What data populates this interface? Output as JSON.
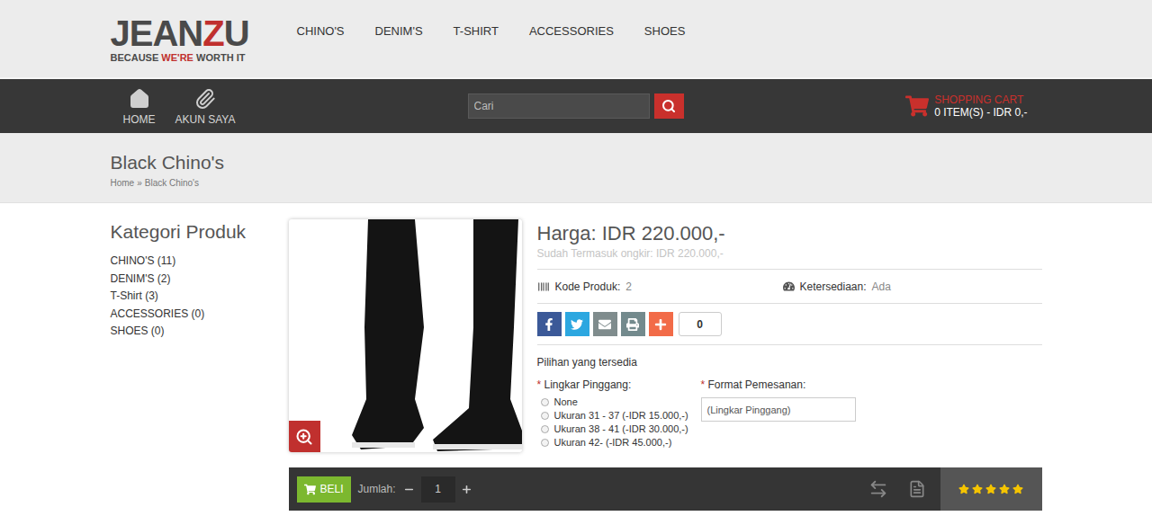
{
  "logo": {
    "title": [
      {
        "text": "JEAN",
        "highlight": false
      },
      {
        "text": "Z",
        "highlight": true
      },
      {
        "text": "U",
        "highlight": false
      }
    ],
    "tagline": [
      {
        "text": "BECAUSE ",
        "highlight": false
      },
      {
        "text": "WE'RE",
        "highlight": true
      },
      {
        "text": " WORTH IT",
        "highlight": false
      }
    ]
  },
  "top_nav": [
    "CHINO'S",
    "DENIM'S",
    "T-SHIRT",
    "ACCESSORIES",
    "SHOES"
  ],
  "main_nav": [
    {
      "label": "HOME",
      "kind": "home"
    },
    {
      "label": "AKUN SAYA",
      "kind": "account"
    }
  ],
  "search": {
    "placeholder": "Cari"
  },
  "cart": {
    "title": "SHOPPING CART",
    "summary": "0 ITEM(S) - IDR 0,-"
  },
  "page": {
    "title": "Black Chino's",
    "breadcrumb": [
      "Home",
      "Black Chino's"
    ],
    "separator": "»"
  },
  "sidebar": {
    "title": "Kategori Produk",
    "items": [
      "CHINO'S (11)",
      "DENIM'S (2)",
      "T-Shirt (3)",
      "ACCESSORIES (0)",
      "SHOES (0)"
    ]
  },
  "product": {
    "price_label": "Harga:",
    "price": "IDR 220.000,-",
    "shipping": "Sudah Termasuk ongkir: IDR 220.000,-",
    "code_label": "Kode Produk:",
    "code": "2",
    "availability_label": "Ketersediaan:",
    "availability": "Ada",
    "share": [
      {
        "kind": "facebook",
        "color": "#3b5998"
      },
      {
        "kind": "twitter",
        "color": "#2ca7e0"
      },
      {
        "kind": "email",
        "color": "#7f8c8d"
      },
      {
        "kind": "print",
        "color": "#738a8d"
      },
      {
        "kind": "more",
        "color": "#f26b48"
      }
    ],
    "share_count": "0",
    "options_title": "Pilihan yang tersedia",
    "required_mark": "*",
    "waist": {
      "label": "Lingkar Pinggang:",
      "options": [
        {
          "label": "None",
          "selected": false
        },
        {
          "label": "Ukuran 31 - 37 (-IDR 15.000,-)",
          "selected": false
        },
        {
          "label": "Ukuran 38 - 41 (-IDR 30.000,-)",
          "selected": false
        },
        {
          "label": "Ukuran 42- (-IDR 45.000,-)",
          "selected": false
        }
      ]
    },
    "format": {
      "label": "Format Pemesanan:",
      "value": "(Lingkar Pinggang)"
    }
  },
  "buy_bar": {
    "button": "BELI",
    "quantity_label": "Jumlah:",
    "quantity": "1",
    "stars": 5
  }
}
